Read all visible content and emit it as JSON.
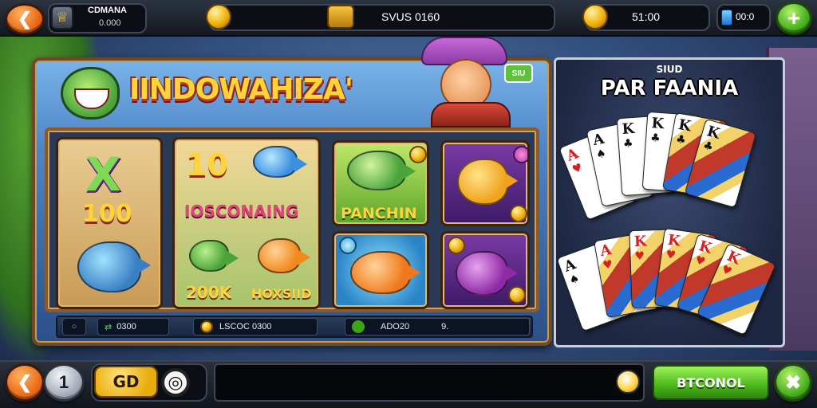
{
  "topbar": {
    "back_icon": "chevron-left-icon",
    "profile": {
      "icon": "trophy-icon",
      "name": "CDMANA",
      "id": "0.000"
    },
    "balance_main": "SVUS 0160",
    "balance_secondary": "51:00",
    "gems": "00:0",
    "add_icon": "plus-icon"
  },
  "main": {
    "game_title": "IINDOWAHIZA'",
    "chef_badge": "SIU",
    "tiles": [
      {
        "top": "X",
        "bottom": "100"
      },
      {
        "top": "10",
        "middle": "IOSCONAING",
        "bottom_left": "200K",
        "bottom_right": "HOXSIID"
      },
      {
        "label": "PANCHIN"
      }
    ],
    "info_strip": {
      "item1": "0300",
      "item2": "LSCOC 0300",
      "item3": "ADO20",
      "item3_suffix": "9."
    }
  },
  "card_panel": {
    "subtitle": "SIUD",
    "title": "PAR FAANIA",
    "top_cards": [
      "A",
      "A",
      "K",
      "K",
      "K",
      "K"
    ],
    "bottom_cards": [
      "A",
      "A",
      "K",
      "K",
      "K",
      "K"
    ]
  },
  "bottombar": {
    "back_icon": "chevron-left-icon",
    "level": "1",
    "bet_label": "GD",
    "target_icon": "target-icon",
    "chat_placeholder": "",
    "avatar_icon": "egg-avatar-icon",
    "action_label": "BTCONOL",
    "close_icon": "close-icon"
  },
  "colors": {
    "accent_green": "#4bb51b",
    "accent_orange": "#e6620f",
    "gold": "#f0b20c"
  }
}
